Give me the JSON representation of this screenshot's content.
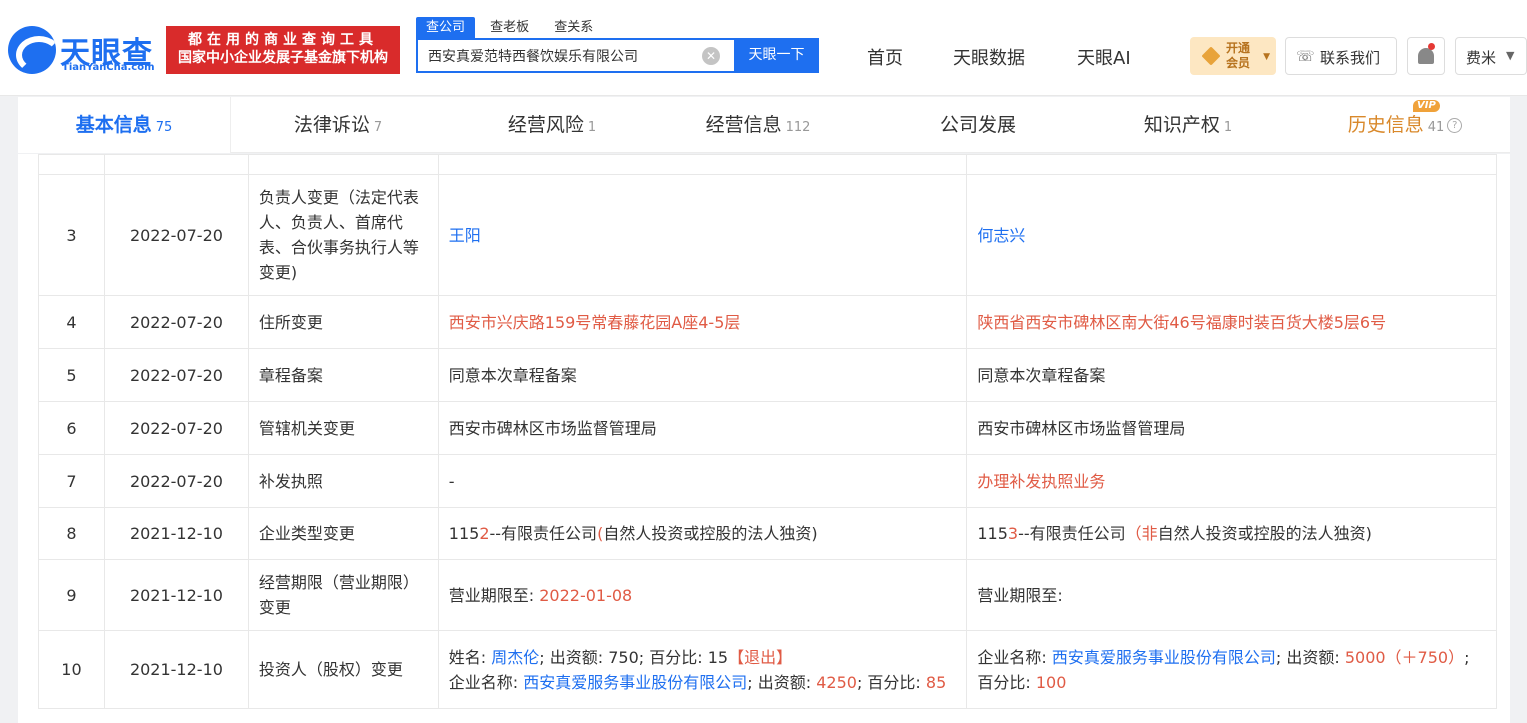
{
  "brand": {
    "name": "天眼查",
    "url": "TianYanCha.com",
    "slogan_line1": "都在用的商业查询工具",
    "slogan_line2": "国家中小企业发展子基金旗下机构"
  },
  "search": {
    "tabs": [
      "查公司",
      "查老板",
      "查关系"
    ],
    "value": "西安真爱范特西餐饮娱乐有限公司",
    "button": "天眼一下"
  },
  "nav": {
    "home": "首页",
    "data": "天眼数据",
    "ai": "天眼AI"
  },
  "vip": {
    "line1": "开通",
    "line2": "会员"
  },
  "contact": "联系我们",
  "user": "费米",
  "tabs": [
    {
      "label": "基本信息",
      "count": "75"
    },
    {
      "label": "法律诉讼",
      "count": "7"
    },
    {
      "label": "经营风险",
      "count": "1"
    },
    {
      "label": "经营信息",
      "count": "112"
    },
    {
      "label": "公司发展",
      "count": ""
    },
    {
      "label": "知识产权",
      "count": "1"
    },
    {
      "label": "历史信息",
      "count": "41",
      "badge": "VIP"
    }
  ],
  "rows": [
    {
      "no": "3",
      "date": "2022-07-20",
      "item": "负责人变更（法定代表人、负责人、首席代表、合伙事务执行人等变更)",
      "before": "王阳",
      "after": "何志兴"
    },
    {
      "no": "4",
      "date": "2022-07-20",
      "item": "住所变更",
      "before": "西安市兴庆路159号常春藤花园A座4-5层",
      "after": "陕西省西安市碑林区南大街46号福康时装百货大楼5层6号"
    },
    {
      "no": "5",
      "date": "2022-07-20",
      "item": "章程备案",
      "before": "同意本次章程备案",
      "after": "同意本次章程备案"
    },
    {
      "no": "6",
      "date": "2022-07-20",
      "item": "管辖机关变更",
      "before": "西安市碑林区市场监督管理局",
      "after": "西安市碑林区市场监督管理局"
    },
    {
      "no": "7",
      "date": "2022-07-20",
      "item": "补发执照",
      "before": "-",
      "after": "办理补发执照业务"
    },
    {
      "no": "8",
      "date": "2021-12-10",
      "item": "企业类型变更",
      "before": {
        "p1": "115",
        "p2": "2",
        "p3": "--有限责任公司",
        "p4": "(",
        "p5": "自然人投资或控股的法人独资)"
      },
      "after": {
        "p1": "115",
        "p2": "3",
        "p3": "--有限责任公司",
        "p4": "（非",
        "p5": "自然人投资或控股的法人独资)"
      }
    },
    {
      "no": "9",
      "date": "2021-12-10",
      "item": "经营期限（营业期限）变更",
      "before": {
        "label": "营业期限至: ",
        "value": "2022-01-08"
      },
      "after": {
        "label": "营业期限至:"
      }
    },
    {
      "no": "10",
      "date": "2021-12-10",
      "item": "投资人（股权）变更",
      "before": {
        "l1_a": "姓名: ",
        "l1_name": "周杰伦",
        "l1_b": "; 出资额: 750; 百分比: 15",
        "l1_tag": "【退出】",
        "l2_a": "企业名称: ",
        "l2_name": "西安真爱服务事业股份有限公司",
        "l2_b": "; 出资额: ",
        "l2_amt": "4250",
        "l2_c": "; 百分比: ",
        "l2_pct": "85"
      },
      "after": {
        "a": "企业名称: ",
        "name": "西安真爱服务事业股份有限公司",
        "b": "; 出资额: ",
        "amt": "5000（＋750",
        "c": "）",
        "d": "; 百分比: ",
        "pct": "100"
      }
    }
  ],
  "colors": {
    "accent": "#1e6ff0",
    "highlight": "#e05b45",
    "history_tab": "#d9882a",
    "brand_red": "#d92b2b"
  }
}
